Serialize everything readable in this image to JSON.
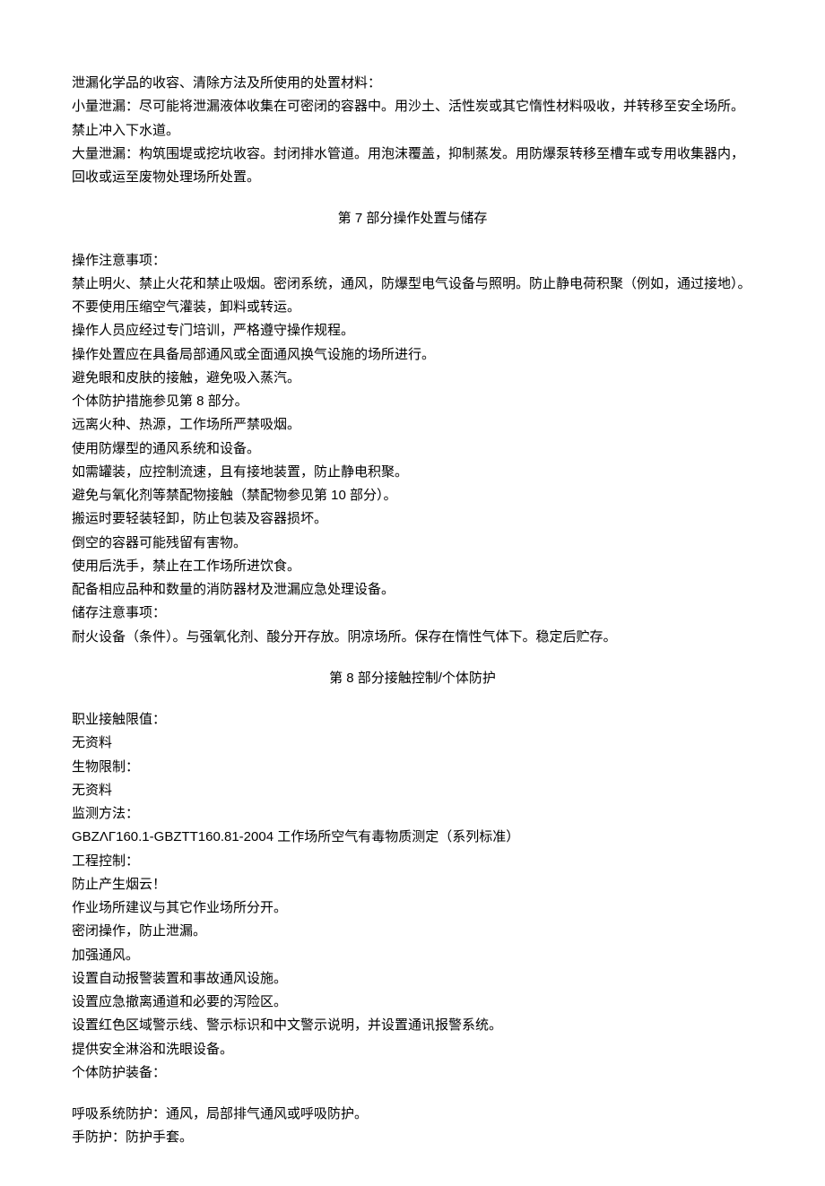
{
  "section6": {
    "line1": "泄漏化学品的收容、清除方法及所使用的处置材料：",
    "line2": "小量泄漏：尽可能将泄漏液体收集在可密闭的容器中。用沙土、活性炭或其它惰性材料吸收，并转移至安全场所。禁止冲入下水道。",
    "line3": "大量泄漏：构筑围堤或挖坑收容。封闭排水管道。用泡沫覆盖，抑制蒸发。用防爆泵转移至槽车或专用收集器内，回收或运至废物处理场所处置。"
  },
  "section7": {
    "title": "第 7 部分操作处置与储存",
    "lines": [
      "操作注意事项：",
      "禁止明火、禁止火花和禁止吸烟。密闭系统，通风，防爆型电气设备与照明。防止静电荷积聚（例如，通过接地）。不要使用压缩空气灌装，卸料或转运。",
      "操作人员应经过专门培训，严格遵守操作规程。",
      "操作处置应在具备局部通风或全面通风换气设施的场所进行。",
      "避免眼和皮肤的接触，避免吸入蒸汽。",
      "个体防护措施参见第 8 部分。",
      "远离火种、热源，工作场所严禁吸烟。",
      "使用防爆型的通风系统和设备。",
      "如需罐装，应控制流速，且有接地装置，防止静电积聚。",
      "避免与氧化剂等禁配物接触（禁配物参见第 10 部分）。",
      "搬运时要轻装轻卸，防止包装及容器损坏。",
      "倒空的容器可能残留有害物。",
      "使用后洗手，禁止在工作场所进饮食。",
      "配备相应品种和数量的消防器材及泄漏应急处理设备。",
      "储存注意事项：",
      "耐火设备（条件）。与强氧化剂、酸分开存放。阴凉场所。保存在惰性气体下。稳定后贮存。"
    ]
  },
  "section8": {
    "title": "第 8 部分接触控制/个体防护",
    "lines": [
      "职业接触限值：",
      "无资料",
      "生物限制：",
      "无资料",
      "监测方法：",
      "GBZΛΓ160.1-GBZTT160.81-2004 工作场所空气有毒物质测定（系列标准）",
      "工程控制：",
      "防止产生烟云！",
      "作业场所建议与其它作业场所分开。",
      "密闭操作，防止泄漏。",
      "加强通风。",
      "设置自动报警装置和事故通风设施。",
      "设置应急撤离通道和必要的泻险区。",
      "设置红色区域警示线、警示标识和中文警示说明，并设置通讯报警系统。",
      "提供安全淋浴和洗眼设备。",
      "个体防护装备："
    ],
    "lines2": [
      "呼吸系统防护：通风，局部排气通风或呼吸防护。",
      "手防护：防护手套。"
    ]
  }
}
